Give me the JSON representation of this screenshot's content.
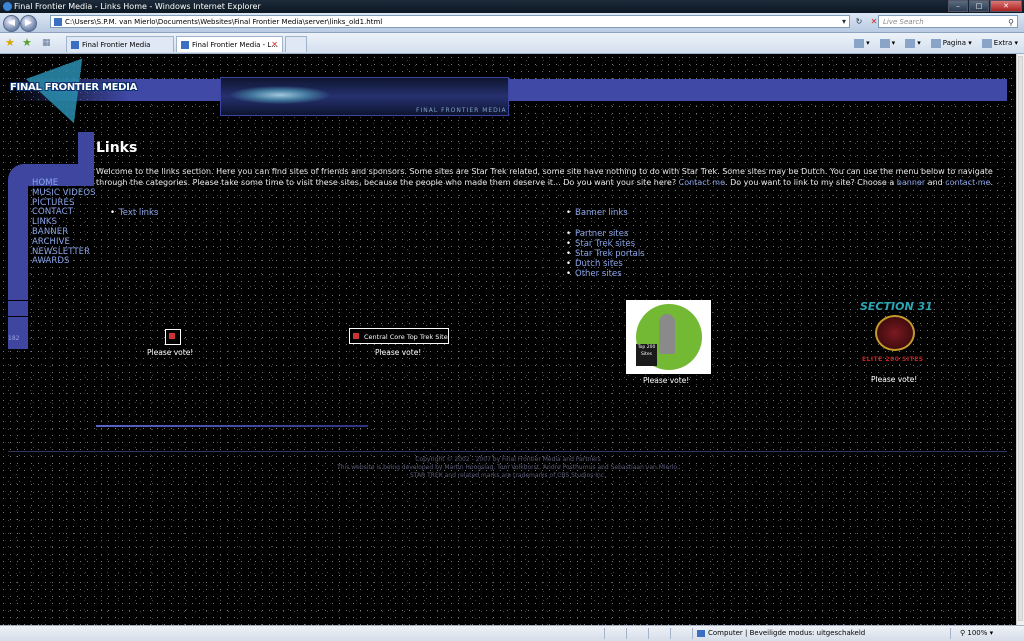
{
  "window": {
    "title": "Final Frontier Media - Links Home - Windows Internet Explorer"
  },
  "address_bar": {
    "url": "C:\\Users\\S.P.M. van Mierlo\\Documents\\Websites\\Final Frontier Media\\server\\links_old1.html",
    "search_placeholder": "Live Search"
  },
  "tabs": [
    {
      "label": "Final Frontier Media",
      "active": false
    },
    {
      "label": "Final Frontier Media - L...",
      "active": true
    }
  ],
  "command_bar": {
    "page_label": "Pagina",
    "extra_label": "Extra"
  },
  "site": {
    "logo_text": "FINAL FRONTIER MEDIA",
    "banner_caption": "FINAL FRONTIER MEDIA",
    "menu": [
      "HOME",
      "MUSIC VIDEOS",
      "PICTURES",
      "CONTACT",
      "LINKS",
      "BANNER",
      "ARCHIVE",
      "NEWSLETTER",
      "AWARDS"
    ],
    "lcars_label": "182"
  },
  "content": {
    "heading": "Links",
    "intro_text_1": "Welcome to the links section. Here you can find sites of friends and sponsors. Some sites are Star Trek related, some site have nothing to do with Star Trek. Some sites may be Dutch. You can use the menu below to navigate through the categories. Please take some time to visit these sites, because the people who made them deserve it... Do you want your site here? ",
    "intro_link_contact": "Contact me",
    "intro_text_2": ". Do you want to link to my site? Choose a ",
    "intro_link_banner": "banner",
    "intro_text_3": " and ",
    "intro_link_contact2": "contact me",
    "intro_text_4": ".",
    "text_links": "Text links",
    "banner_links": "Banner links",
    "categories": [
      "Partner sites",
      "Star Trek sites",
      "Star Trek portals",
      "Dutch sites",
      "Other sites"
    ]
  },
  "voting": {
    "central_core_label": "Central Core Top Trek Sites",
    "top200_sign": "Top 200 Sites",
    "section31_title": "SECTION 31",
    "section31_sub": "ELITE 200 SITES",
    "vote_labels": [
      "Please vote!",
      "Please vote!",
      "Please vote!",
      "Please vote!"
    ]
  },
  "footer": {
    "line1": "Copyright © 2002 - 2007 by Final Frontier Media and Partners",
    "line2": "This website is being developed by Martin Hoogslag, Tom Volkhorst, Andre Posthumus and Sebastiaan van Mierlo.",
    "line3": "STAR TREK and related marks are trademarks of CBS Studios Inc."
  },
  "status_bar": {
    "zone": "Computer | Beveiligde modus: uitgeschakeld",
    "zoom": "100%"
  }
}
